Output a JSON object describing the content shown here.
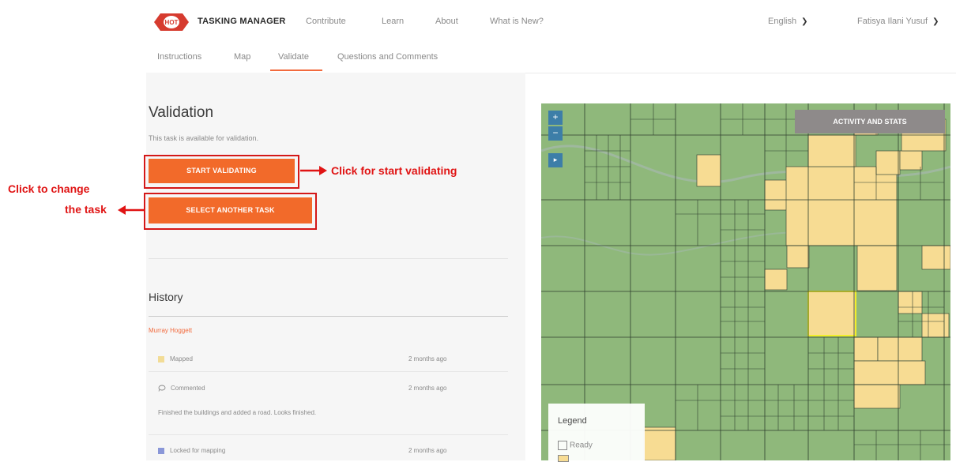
{
  "nav": {
    "brand": "TASKING MANAGER",
    "logo_text": "HOT",
    "links": [
      "Contribute",
      "Learn",
      "About",
      "What is New?"
    ],
    "language": "English",
    "user": "Fatisya Ilani Yusuf"
  },
  "tabs": {
    "items": [
      "Instructions",
      "Map",
      "Validate",
      "Questions and Comments"
    ],
    "active": "Validate"
  },
  "validation": {
    "title": "Validation",
    "availability": "This task is available for validation.",
    "start_button": "START VALIDATING",
    "select_button": "SELECT ANOTHER TASK"
  },
  "annotations": {
    "start": "Click for start validating",
    "change_line1": "Click to change",
    "change_line2": "the task"
  },
  "history": {
    "title": "History",
    "user": "Murray Hoggett",
    "entries": [
      {
        "action": "Mapped",
        "time": "2 months ago",
        "icon": "mapped-square-icon"
      },
      {
        "action": "Commented",
        "time": "2 months ago",
        "icon": "comment-icon"
      },
      {
        "comment": "Finished the buildings and added a road. Looks finished."
      },
      {
        "action": "Locked for mapping",
        "time": "2 months ago",
        "icon": "locked-square-icon"
      }
    ]
  },
  "map": {
    "activity_button": "ACTIVITY AND STATS",
    "zoom_in": "+",
    "zoom_out": "−",
    "layers": "▸",
    "legend_title": "Legend",
    "legend_items": [
      "Ready"
    ],
    "colors": {
      "validated_green": "#8fb87b",
      "mapped_yellow": "#f7dc93",
      "selected_border": "#f2ef2a",
      "grid": "#3a4a3a"
    }
  },
  "colors": {
    "accent": "#f26a2a",
    "annotation_red": "#e01414",
    "map_button": "#3d7ea8"
  }
}
